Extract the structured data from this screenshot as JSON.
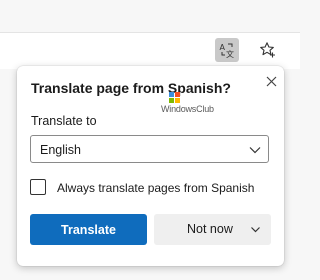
{
  "toolbar": {
    "translate_button_icon": "translate-icon",
    "favorites_button_icon": "star-add-icon"
  },
  "popup": {
    "title": "Translate page from Spanish?",
    "close_icon": "close-icon",
    "translate_to_label": "Translate to",
    "selected_language": "English",
    "always_translate_label": "Always translate pages from Spanish",
    "always_translate_checked": false,
    "translate_button": "Translate",
    "not_now_button": "Not now"
  },
  "watermark": {
    "text": "WindowsClub"
  },
  "colors": {
    "accent": "#0f6cbd",
    "popup_background": "#ffffff",
    "toolbar_highlight": "#c9c9c9"
  }
}
